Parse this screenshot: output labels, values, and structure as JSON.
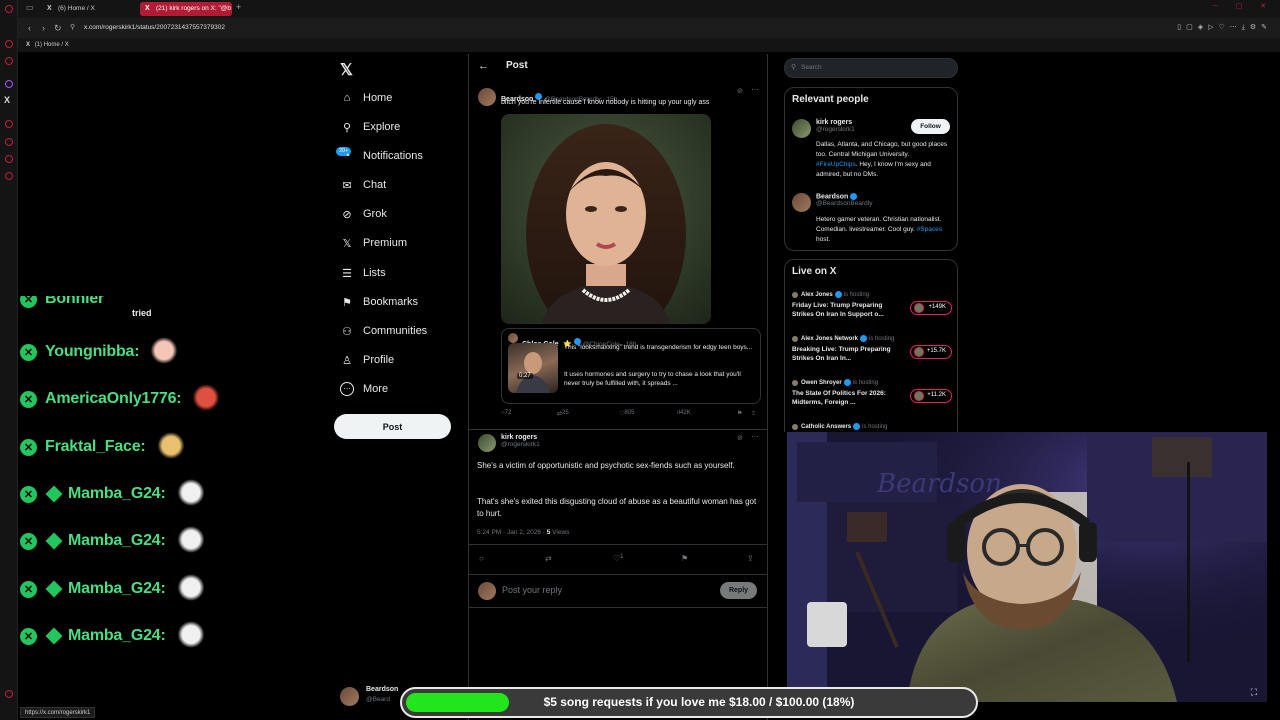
{
  "browser": {
    "tabs": [
      {
        "title": "(6) Home / X"
      },
      {
        "title": "(21) kirk rogers on X: \"@b"
      }
    ],
    "url": "x.com/rogerskirk1/status/2007231437557379302",
    "bookmark": "(1) Home / X",
    "status_url": "https://x.com/rogerskirk1"
  },
  "chat": {
    "cut_name": "Bonnier",
    "cut_emote_text": "tried",
    "messages": [
      {
        "name": "Youngnibba:",
        "badges": 1
      },
      {
        "name": "AmericaOnly1776:",
        "badges": 1
      },
      {
        "name": "Fraktal_Face:",
        "badges": 1
      },
      {
        "name": "Mamba_G24:",
        "badges": 2
      },
      {
        "name": "Mamba_G24:",
        "badges": 2
      },
      {
        "name": "Mamba_G24:",
        "badges": 2
      },
      {
        "name": "Mamba_G24:",
        "badges": 2
      }
    ]
  },
  "nav": {
    "items": [
      {
        "label": "Home",
        "icon": "home-icon"
      },
      {
        "label": "Explore",
        "icon": "search-icon"
      },
      {
        "label": "Notifications",
        "icon": "bell-icon"
      },
      {
        "label": "Chat",
        "icon": "mail-icon"
      },
      {
        "label": "Grok",
        "icon": "grok-icon"
      },
      {
        "label": "Premium",
        "icon": "x-icon"
      },
      {
        "label": "Lists",
        "icon": "list-icon"
      },
      {
        "label": "Bookmarks",
        "icon": "bookmark-icon"
      },
      {
        "label": "Communities",
        "icon": "people-icon"
      },
      {
        "label": "Profile",
        "icon": "person-icon"
      },
      {
        "label": "More",
        "icon": "more-icon"
      }
    ],
    "notif_badge": "20+",
    "post_label": "Post"
  },
  "main": {
    "header": "Post",
    "tweet": {
      "name": "Beardson",
      "handle": "@BeardsonBeardly · 15h",
      "text": "bitch you're infertile cause I know nobody is hitting up your ugly ass"
    },
    "quote": {
      "name": "Chloe Cole",
      "emoji": "⭐",
      "handle": "@ChloeCole · 18h",
      "line1": "This “looksmaxxing” trend is transgenderism for edgy teen boys...",
      "line2": "It uses hormones and surgery to try to chase a look that you'll never truly be fulfilled with, it spreads ...",
      "duration": "0:27"
    },
    "stats": {
      "replies": "72",
      "reposts": "25",
      "likes": "805",
      "views": "42K"
    },
    "reply": {
      "name": "kirk rogers",
      "handle": "@rogerskirk1",
      "text1": "She's a victim of opportunistic and psychotic sex-fiends such as yourself.",
      "text2": "That's she's exited this disgusting cloud of abuse as a beautiful woman has got to hurt.",
      "time": "5:24 PM · Jan 2, 2026 · ",
      "views_count": "5",
      "views_label": " Views",
      "likes": "1"
    },
    "reply_box": {
      "placeholder": "Post your reply",
      "button": "Reply"
    }
  },
  "right": {
    "search_placeholder": "Search",
    "relevant": {
      "title": "Relevant people",
      "people": [
        {
          "name": "kirk rogers",
          "handle": "@rogerskirk1",
          "follow": "Follow",
          "bio_a": "Dallas, Atlanta, and Chicago, but good places too. Central Michigan University. ",
          "bio_link": "#FireUpChips",
          "bio_b": ". Hey, I know I'm sexy and admired, but no DMs."
        },
        {
          "name": "Beardson",
          "handle": "@BeardsonBeardly",
          "bio_a": "Hetero gamer veteran. Christian nationalist. Comedian. livestreamer. Cool guy. ",
          "bio_link": "#Spaces",
          "bio_b": " host."
        }
      ]
    },
    "live": {
      "title": "Live on X",
      "hosting_label": "is hosting",
      "items": [
        {
          "host": "Alex Jones",
          "title": "Friday Live: Trump Preparing Strikes On Iran In Support o...",
          "count": "+149K"
        },
        {
          "host": "Alex Jones Network",
          "title": "Breaking Live: Trump Preparing Strikes On Iran In...",
          "count": "+15.7K"
        },
        {
          "host": "Owen Shroyer",
          "title": "The State Of Politics For 2026: Midterms, Foreign ...",
          "count": "+11.2K"
        },
        {
          "host": "Catholic Answers",
          "title": "",
          "count": ""
        }
      ]
    }
  },
  "bottom_account": {
    "name": "Beardson",
    "handle": "@Beard"
  },
  "goal": {
    "text": "$5 song requests if you love me $18.00 / $100.00 (18%)",
    "progress": 0.18
  },
  "colors": {
    "accent": "#1d9bf0",
    "chat_green": "#4ade80",
    "goal_green": "#22e51c",
    "live_ring": "#e0245e",
    "browser_active_tab": "#b01c34"
  }
}
